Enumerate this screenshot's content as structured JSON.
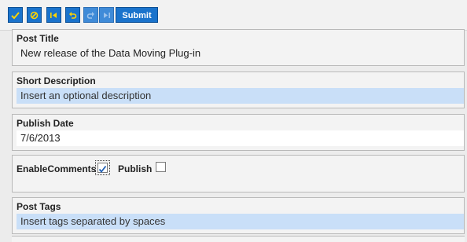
{
  "toolbar": {
    "buttons": [
      {
        "icon": "checkmark-icon",
        "enabled": true
      },
      {
        "icon": "cancel-icon",
        "enabled": true
      },
      {
        "icon": "first-icon",
        "enabled": true
      },
      {
        "icon": "undo-icon",
        "enabled": true
      },
      {
        "icon": "redo-icon",
        "enabled": false
      },
      {
        "icon": "last-icon",
        "enabled": false
      }
    ],
    "submit_label": "Submit"
  },
  "form": {
    "post_title": {
      "label": "Post Title",
      "value": "New release of the Data Moving Plug-in"
    },
    "short_description": {
      "label": "Short Description",
      "placeholder": "Insert an optional description"
    },
    "publish_date": {
      "label": "Publish Date",
      "value": "7/6/2013"
    },
    "enable_comments": {
      "label": "EnableComments",
      "checked": true
    },
    "publish": {
      "label": "Publish",
      "checked": false
    },
    "post_tags": {
      "label": "Post Tags",
      "placeholder": "Insert tags separated by spaces"
    }
  },
  "colors": {
    "toolbar_button": "#1a73cc",
    "hint_field_bg": "#c9dff8",
    "check_mark": "#1f5fb5"
  }
}
